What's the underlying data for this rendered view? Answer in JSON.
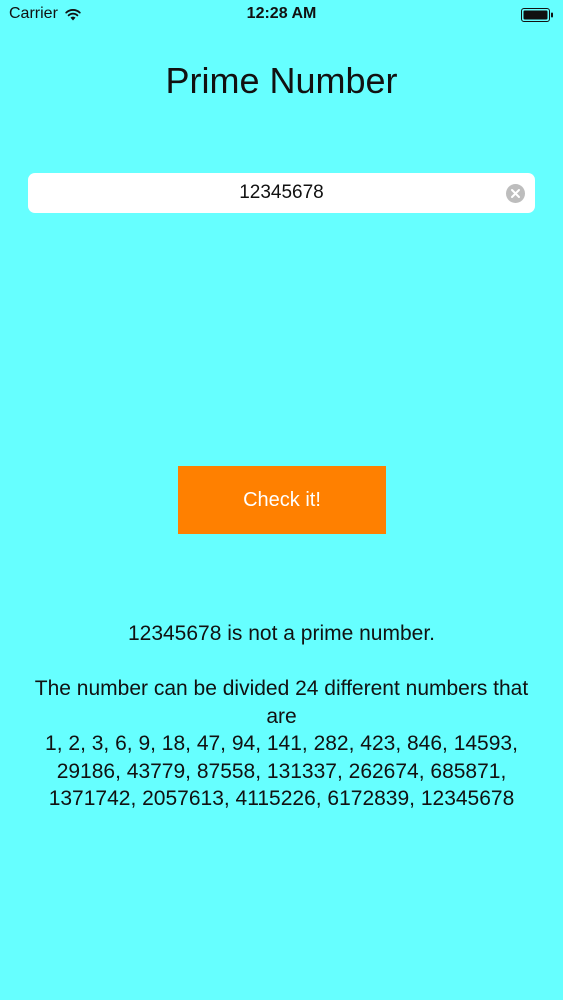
{
  "status_bar": {
    "carrier": "Carrier",
    "time": "12:28 AM"
  },
  "title": "Prime Number",
  "input": {
    "value": "12345678",
    "placeholder": ""
  },
  "check_button": {
    "label": "Check it!"
  },
  "result": {
    "headline": "12345678 is not a prime number.",
    "detail_intro": "The number can be divided 24 different numbers that are",
    "divisors_text": "1, 2, 3, 6, 9, 18, 47, 94, 141, 282, 423, 846, 14593, 29186, 43779, 87558, 131337, 262674, 685871, 1371742, 2057613, 4115226, 6172839, 12345678"
  },
  "colors": {
    "background": "#66FFFF",
    "button": "#FF8000",
    "button_text": "#FFFFFF",
    "caret": "#2F5FE0"
  },
  "icons": {
    "wifi": "wifi-icon",
    "battery": "battery-icon",
    "clear": "clear-icon"
  }
}
